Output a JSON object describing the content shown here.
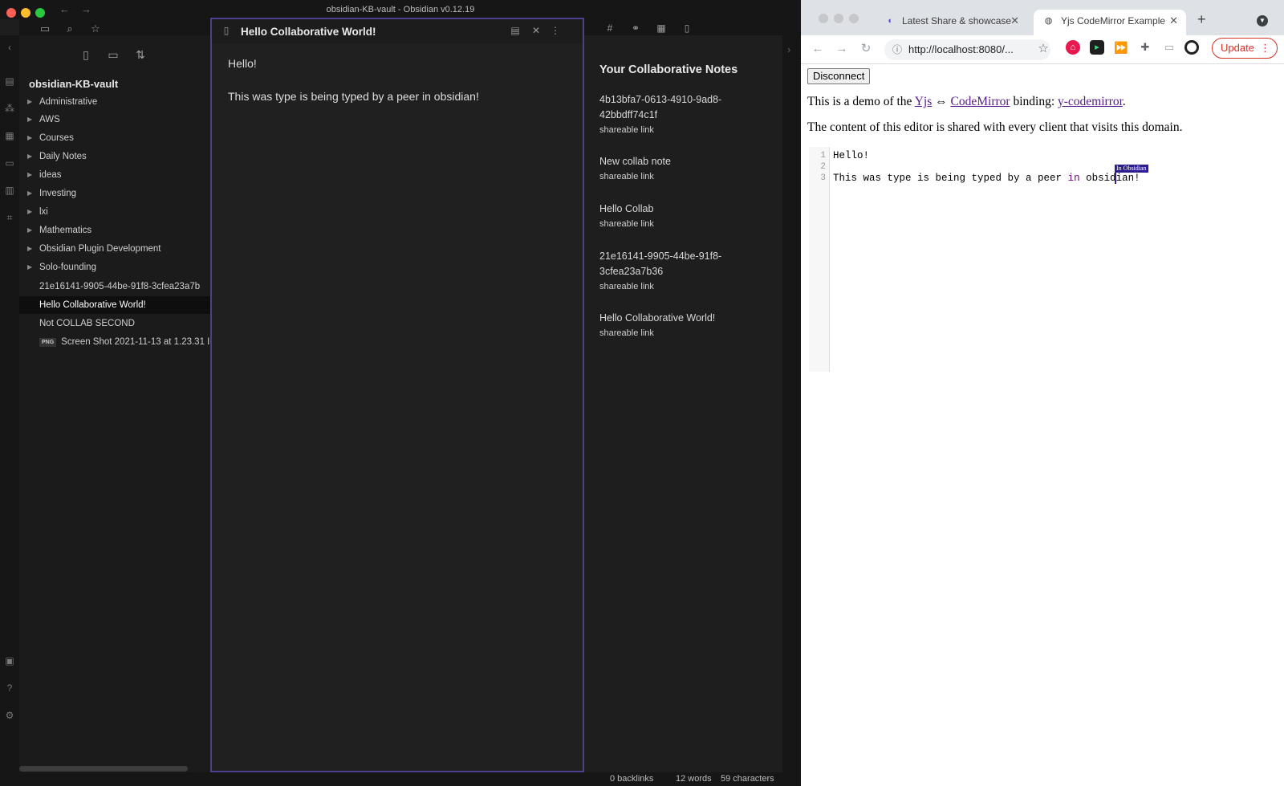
{
  "obsidian": {
    "window_title": "obsidian-KB-vault - Obsidian v0.12.19",
    "vault_name": "obsidian-KB-vault",
    "folders": [
      {
        "label": "Administrative"
      },
      {
        "label": "AWS"
      },
      {
        "label": "Courses"
      },
      {
        "label": "Daily Notes"
      },
      {
        "label": "ideas"
      },
      {
        "label": "Investing"
      },
      {
        "label": "lxi"
      },
      {
        "label": "Mathematics"
      },
      {
        "label": "Obsidian Plugin Development"
      },
      {
        "label": "Solo-founding"
      }
    ],
    "files": [
      {
        "label": "21e16141-9905-44be-91f8-3cfea23a7b"
      },
      {
        "label": "Hello Collaborative World!"
      },
      {
        "label": "Not COLLAB SECOND"
      },
      {
        "label": "Screen Shot 2021-11-13 at 1.23.31 I",
        "badge": "PNG"
      }
    ],
    "editor": {
      "title": "Hello Collaborative World!",
      "lines": [
        "Hello!",
        "This was type is being typed by a peer in obsidian!"
      ]
    },
    "collab_panel": {
      "heading": "Your Collaborative Notes",
      "link_label": "shareable link",
      "notes": [
        {
          "title": "4b13bfa7-0613-4910-9ad8-42bbdff74c1f"
        },
        {
          "title": "New collab note"
        },
        {
          "title": "Hello Collab"
        },
        {
          "title": "21e16141-9905-44be-91f8-3cfea23a7b36"
        },
        {
          "title": "Hello Collaborative World!"
        }
      ]
    },
    "status": {
      "backlinks": "0 backlinks",
      "words": "12 words",
      "characters": "59 characters"
    },
    "colors": {
      "accent": "#4b3f8f",
      "background": "#1e1e1e"
    }
  },
  "browser": {
    "tabs": [
      {
        "label": "Latest Share & showcase"
      },
      {
        "label": "Yjs CodeMirror Example"
      }
    ],
    "url": "http://localhost:8080/...",
    "update_label": "Update",
    "page": {
      "disconnect_label": "Disconnect",
      "intro_prefix": "This is a demo of the ",
      "link_yjs": "Yjs",
      "arrow": " ⇔ ",
      "link_codemirror": "CodeMirror",
      "binding_text": " binding: ",
      "link_ycodemirror": "y-codemirror",
      "period": ".",
      "shared_text": "The content of this editor is shared with every client that visits this domain.",
      "editor_lines": [
        {
          "num": "1",
          "text": "Hello!"
        },
        {
          "num": "2",
          "text": ""
        },
        {
          "num": "3",
          "before": "This was type is being typed by a peer ",
          "keyword": "in",
          "after": " obsidian!"
        }
      ],
      "remote_cursor_label": "In Obsidian"
    }
  }
}
